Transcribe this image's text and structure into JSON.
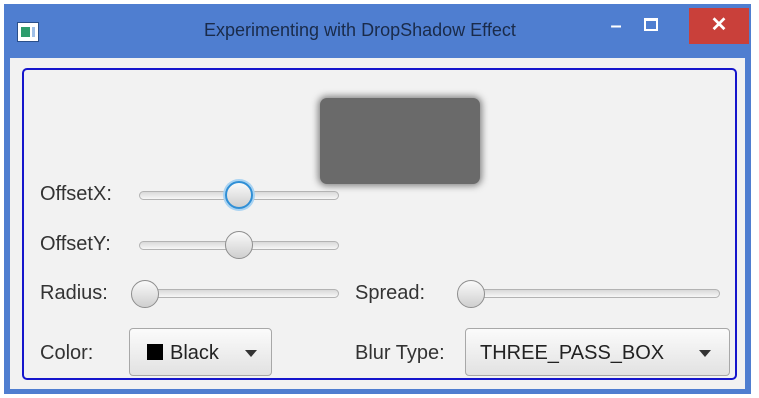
{
  "window": {
    "title": "Experimenting with DropShadow Effect",
    "close_glyph": "✕",
    "minimize_glyph": "–"
  },
  "controls": {
    "offset_x": {
      "label": "OffsetX:",
      "value_fraction": 0.5
    },
    "offset_y": {
      "label": "OffsetY:",
      "value_fraction": 0.5
    },
    "radius": {
      "label": "Radius:",
      "value_fraction": 0.0
    },
    "spread": {
      "label": "Spread:",
      "value_fraction": 0.0
    },
    "color": {
      "label": "Color:",
      "selected": "Black",
      "swatch": "#000000"
    },
    "blur_type": {
      "label": "Blur Type:",
      "selected": "THREE_PASS_BOX"
    }
  },
  "colors": {
    "titlebar": "#4f7ed0",
    "close_button": "#c9403a",
    "focus_border": "#1616cc",
    "preview_fill": "#6a6a6a"
  },
  "icons": {
    "app": "app-icon",
    "minimize": "minimize-icon",
    "maximize": "maximize-icon",
    "close": "close-icon",
    "dropdown": "chevron-down-icon"
  }
}
